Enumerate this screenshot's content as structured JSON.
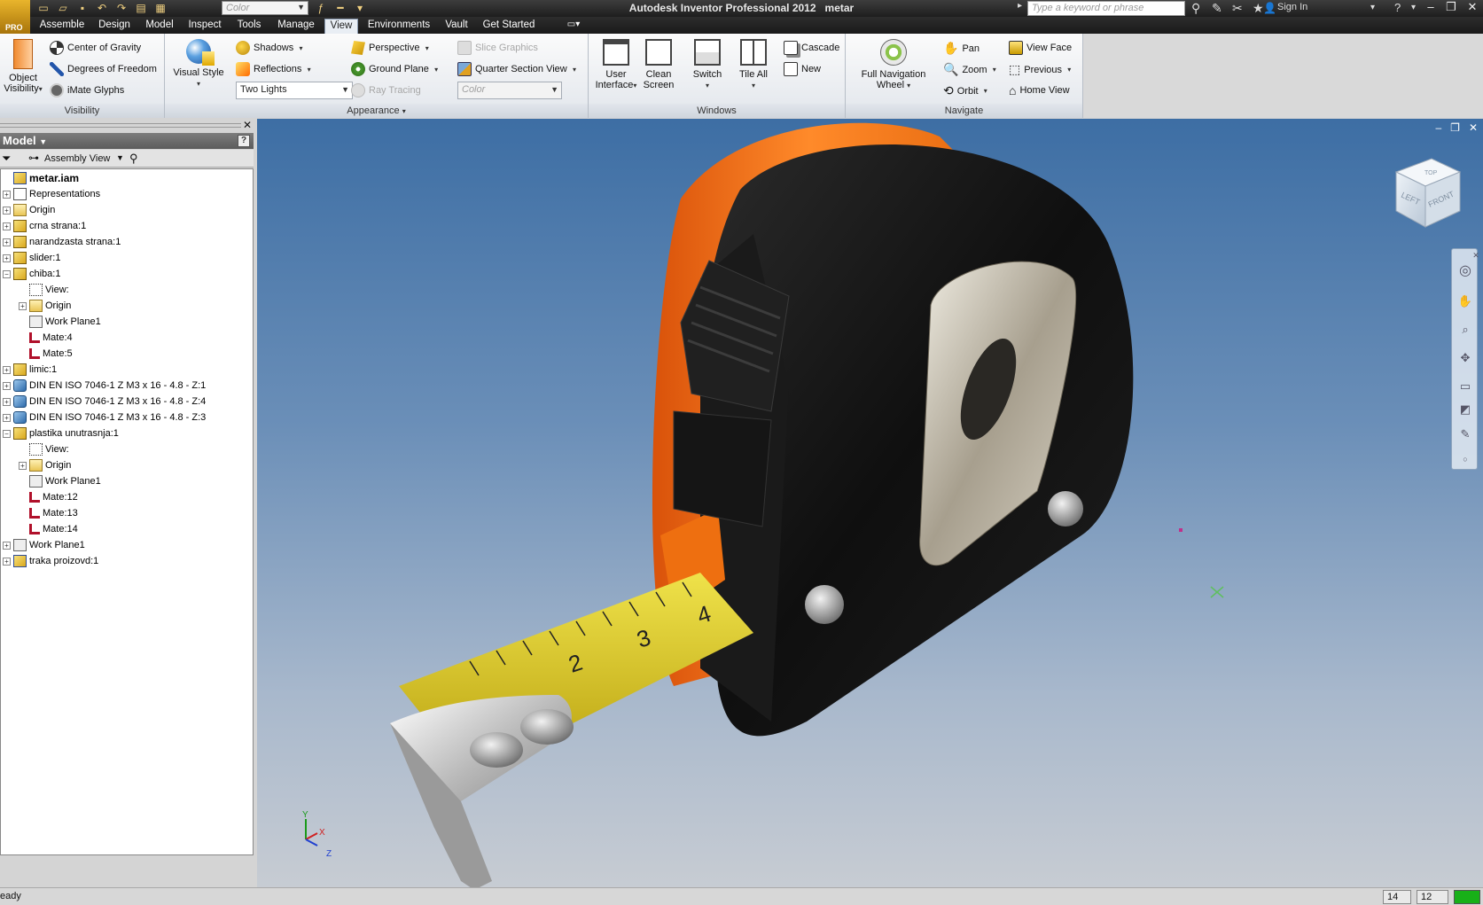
{
  "window": {
    "title": "Autodesk Inventor Professional 2012",
    "document": "metar",
    "pro_badge": "PRO"
  },
  "quick_access": {
    "appearance_combo": "Color"
  },
  "search": {
    "placeholder": "Type a keyword or phrase"
  },
  "account": {
    "sign_in": "Sign In"
  },
  "tabs": [
    {
      "label": "Assemble"
    },
    {
      "label": "Design"
    },
    {
      "label": "Model"
    },
    {
      "label": "Inspect"
    },
    {
      "label": "Tools"
    },
    {
      "label": "Manage"
    },
    {
      "label": "View",
      "active": true
    },
    {
      "label": "Environments"
    },
    {
      "label": "Vault"
    },
    {
      "label": "Get Started"
    }
  ],
  "ribbon": {
    "visibility": {
      "title": "Visibility",
      "object_visibility_1": "Object",
      "object_visibility_2": "Visibility",
      "center_of_gravity": "Center of Gravity",
      "degrees_of_freedom": "Degrees of Freedom",
      "imate_glyphs": "iMate Glyphs"
    },
    "appearance": {
      "title": "Appearance",
      "visual_style": "Visual Style",
      "shadows": "Shadows",
      "reflections": "Reflections",
      "lighting_combo": "Two Lights",
      "perspective": "Perspective",
      "ground_plane": "Ground Plane",
      "ray_tracing": "Ray Tracing",
      "slice_graphics": "Slice Graphics",
      "quarter_section_view": "Quarter Section View",
      "color_combo": "Color"
    },
    "windows": {
      "title": "Windows",
      "user_interface_1": "User",
      "user_interface_2": "Interface",
      "clean_screen_1": "Clean",
      "clean_screen_2": "Screen",
      "switch": "Switch",
      "tile_all": "Tile All",
      "cascade": "Cascade",
      "new": "New"
    },
    "navigate": {
      "title": "Navigate",
      "full_nav_1": "Full Navigation",
      "full_nav_2": "Wheel",
      "pan": "Pan",
      "zoom": "Zoom",
      "orbit": "Orbit",
      "view_face": "View Face",
      "previous": "Previous",
      "home_view": "Home View"
    }
  },
  "browser": {
    "title": "Model",
    "help": "?",
    "toolbar_view": "Assembly View",
    "tree": [
      {
        "label": "metar.iam",
        "level": 0,
        "icon": "asm",
        "expand": "",
        "bold": true
      },
      {
        "label": "Representations",
        "level": 0,
        "icon": "rep",
        "expand": "+"
      },
      {
        "label": "Origin",
        "level": 0,
        "icon": "folder",
        "expand": "+"
      },
      {
        "label": "crna strana:1",
        "level": 0,
        "icon": "part",
        "expand": "+"
      },
      {
        "label": "narandzasta strana:1",
        "level": 0,
        "icon": "part",
        "expand": "+"
      },
      {
        "label": "slider:1",
        "level": 0,
        "icon": "part",
        "expand": "+"
      },
      {
        "label": "chiba:1",
        "level": 0,
        "icon": "part",
        "expand": "−"
      },
      {
        "label": "View:",
        "level": 1,
        "icon": "view",
        "expand": ""
      },
      {
        "label": "Origin",
        "level": 1,
        "icon": "folder",
        "expand": "+"
      },
      {
        "label": "Work Plane1",
        "level": 1,
        "icon": "plane",
        "expand": ""
      },
      {
        "label": "Mate:4",
        "level": 1,
        "icon": "mate",
        "expand": ""
      },
      {
        "label": "Mate:5",
        "level": 1,
        "icon": "mate",
        "expand": ""
      },
      {
        "label": "limic:1",
        "level": 0,
        "icon": "part",
        "expand": "+"
      },
      {
        "label": "DIN EN ISO 7046-1 Z M3 x 16 - 4.8 - Z:1",
        "level": 0,
        "icon": "bolt",
        "expand": "+"
      },
      {
        "label": "DIN EN ISO 7046-1 Z M3 x 16 - 4.8 - Z:4",
        "level": 0,
        "icon": "bolt",
        "expand": "+"
      },
      {
        "label": "DIN EN ISO 7046-1 Z M3 x 16 - 4.8 - Z:3",
        "level": 0,
        "icon": "bolt",
        "expand": "+"
      },
      {
        "label": "plastika unutrasnja:1",
        "level": 0,
        "icon": "part",
        "expand": "−"
      },
      {
        "label": "View:",
        "level": 1,
        "icon": "view",
        "expand": ""
      },
      {
        "label": "Origin",
        "level": 1,
        "icon": "folder",
        "expand": "+"
      },
      {
        "label": "Work Plane1",
        "level": 1,
        "icon": "plane",
        "expand": ""
      },
      {
        "label": "Mate:12",
        "level": 1,
        "icon": "mate",
        "expand": ""
      },
      {
        "label": "Mate:13",
        "level": 1,
        "icon": "mate",
        "expand": ""
      },
      {
        "label": "Mate:14",
        "level": 1,
        "icon": "mate",
        "expand": ""
      },
      {
        "label": "Work Plane1",
        "level": 0,
        "icon": "plane",
        "expand": "+"
      },
      {
        "label": "traka proizovd:1",
        "level": 0,
        "icon": "asm",
        "expand": "+"
      }
    ]
  },
  "viewport": {
    "viewcube_left": "LEFT",
    "viewcube_front": "FRONT",
    "viewcube_top": "TOP",
    "tape_numbers": [
      "2",
      "3",
      "4"
    ],
    "triad_y": "Y",
    "triad_x": "X",
    "triad_z": "Z"
  },
  "status": {
    "text": "eady",
    "field1": "14",
    "field2": "12"
  },
  "colors": {
    "orange": "#f07a1a",
    "black_body": "#151515",
    "tape_yellow": "#e5d21a",
    "bg_top": "#3d6ea4"
  }
}
